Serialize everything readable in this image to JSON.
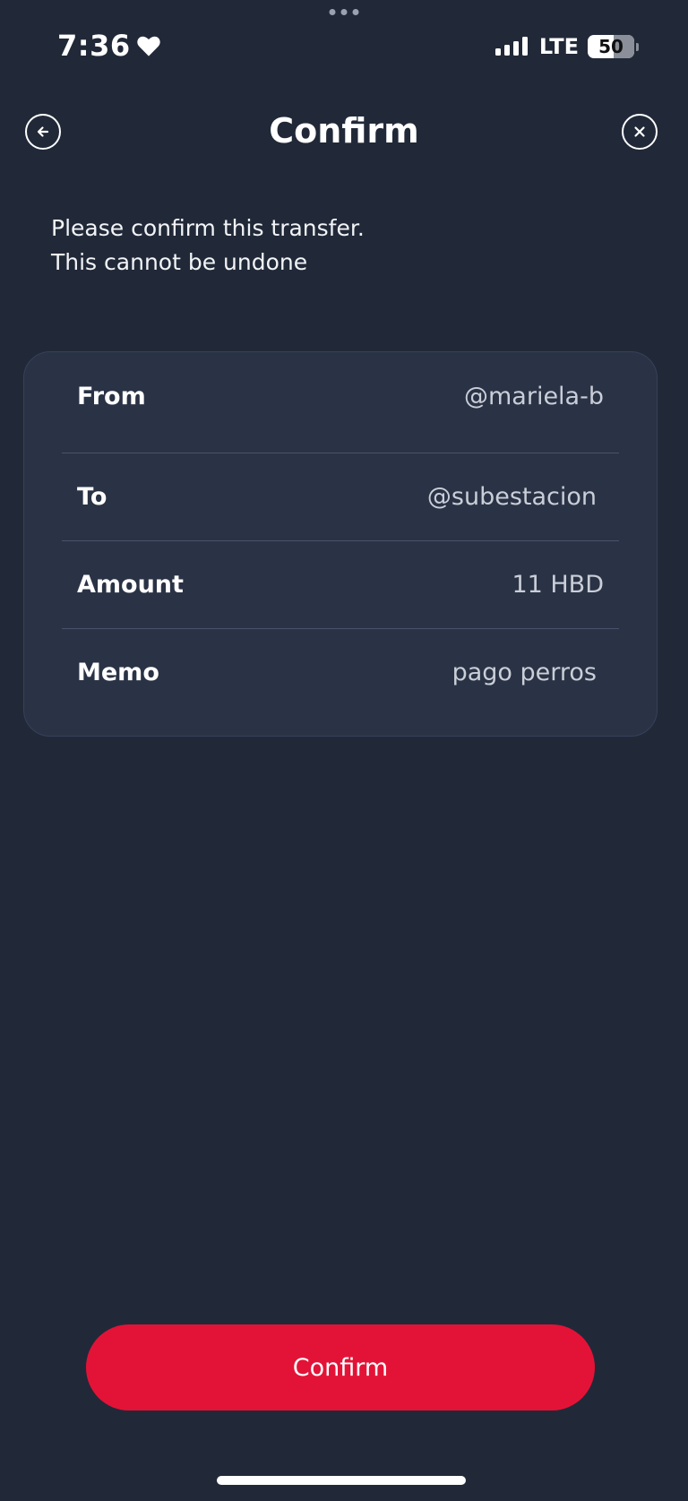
{
  "status_bar": {
    "time": "7:36",
    "network": "LTE",
    "battery": "50"
  },
  "header": {
    "title": "Confirm",
    "back_icon": "arrow-left-circle-icon",
    "close_icon": "close-circle-icon"
  },
  "description": {
    "line1": "Please confirm this transfer.",
    "line2": "This cannot be undone"
  },
  "details": {
    "rows": [
      {
        "label": "From",
        "value": "@mariela-b"
      },
      {
        "label": "To",
        "value": "@subestacion"
      },
      {
        "label": "Amount",
        "value": "11 HBD"
      },
      {
        "label": "Memo",
        "value": "pago perros"
      }
    ]
  },
  "actions": {
    "confirm_label": "Confirm"
  },
  "colors": {
    "background": "#212938",
    "card": "#2a3345",
    "accent": "#e31337"
  }
}
